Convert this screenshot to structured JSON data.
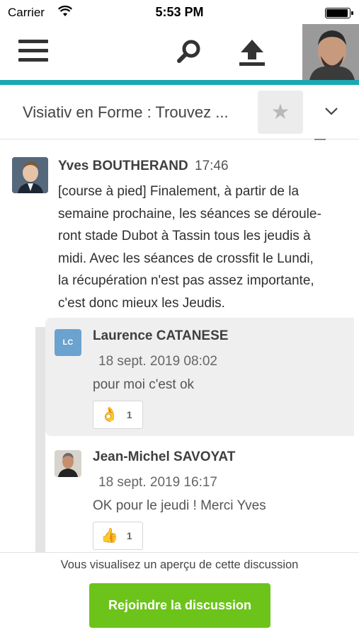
{
  "status_bar": {
    "carrier": "Carrier",
    "time": "5:53 PM",
    "wifi_icon": "wifi-icon",
    "battery_icon": "battery-icon"
  },
  "app_bar": {
    "menu_icon": "hamburger-menu-icon",
    "search_icon": "search-icon",
    "upload_icon": "upload-icon",
    "accent_color": "#1aa8b2"
  },
  "discussion": {
    "title": "Visiativ en Forme : Trouvez ...",
    "star_icon": "star-icon",
    "chevron_icon": "chevron-down-icon"
  },
  "post": {
    "author": "Yves BOUTHERAND",
    "time": "17:46",
    "lines": [
      "[course à pied] Finalement, à partir de la",
      "semaine prochaine, les séances se déroule-",
      "ront stade Dubot à Tassin tous les jeudis à",
      "midi. Avec les séances de crossfit le Lundi,",
      "la récupération n'est pas assez importante,",
      "c'est donc mieux les Jeudis."
    ]
  },
  "replies": [
    {
      "initials": "LC",
      "author": "Laurence CATANESE",
      "date": "18 sept. 2019 08:02",
      "text": "pour moi c'est ok",
      "reaction_emoji": "👌",
      "reaction_count": "1"
    },
    {
      "author": "Jean-Michel SAVOYAT",
      "date": "18 sept. 2019 16:17",
      "text": "OK pour le jeudi ! Merci Yves",
      "reaction_emoji": "👍",
      "reaction_count": "1"
    }
  ],
  "footer": {
    "preview_text": "Vous visualisez un aperçu de cette discussion",
    "join_label": "Rejoindre la discussion",
    "join_color": "#6cc41a"
  }
}
